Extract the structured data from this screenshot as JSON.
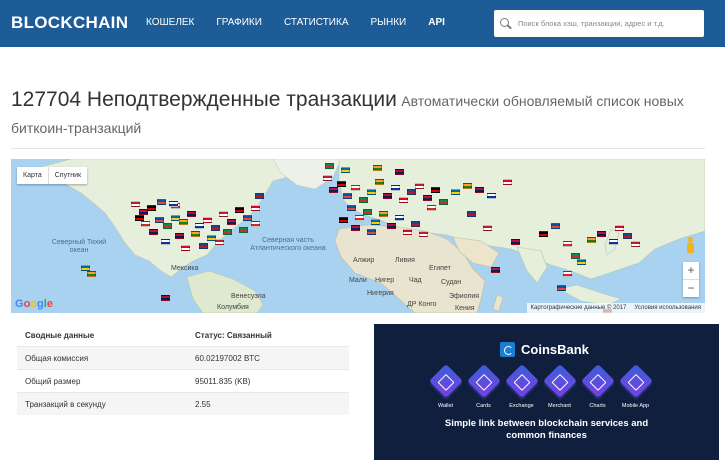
{
  "header": {
    "logo": "BLOCKCHAIN",
    "nav": [
      "КОШЕЛЕК",
      "ГРАФИКИ",
      "СТАТИСТИКА",
      "РЫНКИ",
      "API"
    ],
    "search_placeholder": "Поиск блока хэш, транзакции, адрес и т.д.",
    "colors": {
      "bar": "#1d5c96"
    }
  },
  "page": {
    "title_main": "127704 Неподтвержденные транзакции",
    "title_sub": "Автоматически обновляемый список новых биткоин-транзакций"
  },
  "map": {
    "type_buttons": [
      "Карта",
      "Спутник"
    ],
    "labels": {
      "north_pacific": "Северный Тихий океан",
      "north_atlantic": "Северная часть Атлантического океана",
      "mexico": "Мексика",
      "venezuela": "Венесуэла",
      "colombia": "Колумбия",
      "algeria": "Алжир",
      "libya": "Ливия",
      "egypt": "Египет",
      "mali": "Мали",
      "niger": "Нигер",
      "chad": "Чад",
      "sudan": "Судан",
      "nigeria": "Нигерия",
      "ethiopia": "Эфиопия",
      "dr_congo": "ДР Конго",
      "kenya": "Кения"
    },
    "footer_copyright": "Картографические данные © 2017",
    "footer_terms": "Условия использования",
    "zoom_in": "+",
    "zoom_out": "−"
  },
  "stats": {
    "header": {
      "label": "Сводные данные",
      "status": "Статус: Связанный"
    },
    "rows": [
      {
        "label": "Общая комиссия",
        "value": "60.02197002 BTC"
      },
      {
        "label": "Общий размер",
        "value": "95011.835 (KB)"
      },
      {
        "label": "Транзакций в секунду",
        "value": "2.55"
      }
    ]
  },
  "banner": {
    "brand": "CoinsBank",
    "services": [
      "Wallet",
      "Cards",
      "Exchange",
      "Merchant",
      "Charts",
      "Mobile App"
    ],
    "tagline_1": "Simple link between blockchain services and",
    "tagline_2": "common finances"
  }
}
